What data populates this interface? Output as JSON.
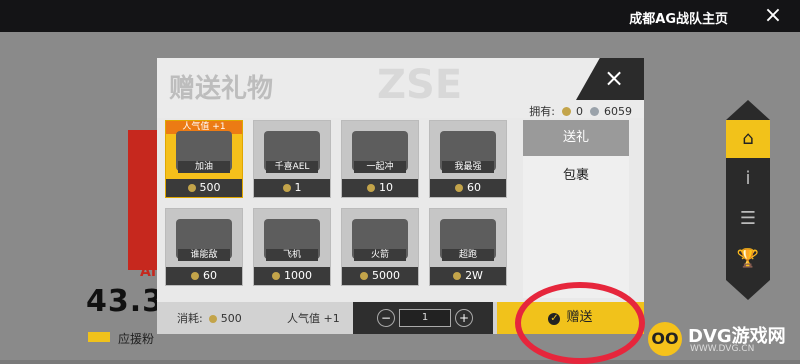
{
  "topbar": {
    "title": "成都AG战队主页",
    "close_icon": "×"
  },
  "background": {
    "big_number": "43.3",
    "red_letters": "AI",
    "cheer_label": "应援粉"
  },
  "sidebar": {
    "items": [
      {
        "icon": "home-icon",
        "glyph": "⌂"
      },
      {
        "icon": "info-icon",
        "glyph": "i"
      },
      {
        "icon": "chat-icon",
        "glyph": "☰"
      },
      {
        "icon": "trophy-icon",
        "glyph": "🏆"
      }
    ]
  },
  "dialog": {
    "title": "赠送礼物",
    "watermark": "ZSE",
    "owned_label": "拥有:",
    "owned_coin": "0",
    "owned_gem": "6059",
    "gifts": [
      {
        "label": "加油",
        "price": "500",
        "popularity": "人气值 +1",
        "selected": true
      },
      {
        "label": "千喜AEL",
        "price": "1"
      },
      {
        "label": "一起冲",
        "price": "10"
      },
      {
        "label": "我最强",
        "price": "60"
      },
      {
        "label": "谁能敌",
        "price": "60"
      },
      {
        "label": "飞机",
        "price": "1000"
      },
      {
        "label": "火箭",
        "price": "5000"
      },
      {
        "label": "超跑",
        "price": "2W"
      }
    ],
    "right": {
      "send_label": "送礼",
      "pack_label": "包裹"
    },
    "bottom": {
      "cost_label": "消耗:",
      "cost_value": "500",
      "popularity_label": "人气值",
      "popularity_value": "+1",
      "qty_minus": "−",
      "qty_value": "1",
      "qty_plus": "+",
      "give_label": "赠送",
      "check_glyph": "✓"
    },
    "close_glyph": "×"
  },
  "logo": {
    "text": "DVG游戏网",
    "sub": "WWW.DVG.CN",
    "badge": "OO"
  },
  "colors": {
    "accent": "#f1c21b",
    "ring": "#e6263c",
    "orange": "#ec7b14"
  }
}
